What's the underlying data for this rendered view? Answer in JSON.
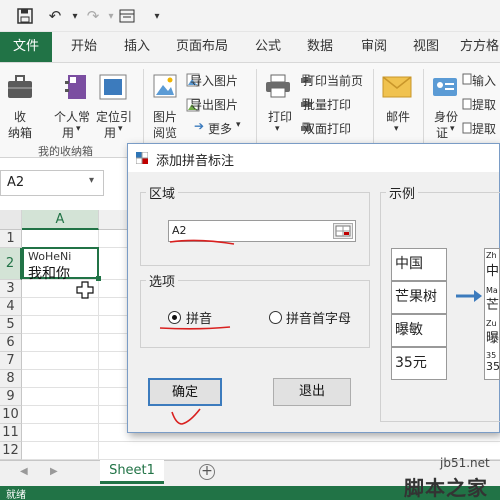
{
  "ribbon_tabs": [
    "文件",
    "开始",
    "插入",
    "页面布局",
    "公式",
    "数据",
    "审阅",
    "视图",
    "方方格"
  ],
  "ribbon": {
    "btn_collect_l1": "收",
    "btn_collect_l2": "纳箱",
    "btn_personal_l1": "个人常",
    "btn_personal_l2": "用",
    "btn_locate_l1": "定位引",
    "btn_locate_l2": "用",
    "group_name": "我的收纳箱",
    "btn_imgview_l1": "图片",
    "btn_imgview_l2": "阅览",
    "import_image": "导入图片",
    "export_image": "导出图片",
    "more": "更多",
    "btn_print": "打印",
    "print_current": "打印当前页",
    "batch_print": "批量打印",
    "duplex_print": "双面打印",
    "btn_mail": "邮件",
    "btn_id_l1": "身份",
    "btn_id_l2": "证",
    "input_cut": "输入",
    "extract1": "提取",
    "extract2": "提取"
  },
  "namebox": "A2",
  "columns": [
    "A"
  ],
  "rows": [
    "1",
    "2",
    "3",
    "4",
    "5",
    "6",
    "7",
    "8",
    "9",
    "10",
    "11",
    "12"
  ],
  "cell_a2": {
    "pinyin": "WoHeNi",
    "text": "我和你"
  },
  "sheet_tab": "Sheet1",
  "status_text": "就绪",
  "dialog": {
    "title": "添加拼音标注",
    "region_label": "区域",
    "region_value": "A2",
    "options_label": "选项",
    "radio_pinyin": "拼音",
    "radio_initials": "拼音首字母",
    "ok": "确定",
    "exit": "退出",
    "example_label": "示例",
    "example_cells": [
      "中国",
      "芒果树",
      "曝敏",
      "35元"
    ],
    "example_result_pinyin": [
      "Zh",
      "Ma",
      "Zu",
      "35"
    ],
    "example_result_text": [
      "中",
      "芒",
      "曝",
      "35"
    ]
  },
  "watermark": {
    "site": "jb51.net",
    "brand": "脚本之家"
  },
  "colors": {
    "excel_green": "#217346",
    "annotation_red": "#d9201f",
    "arrow_blue": "#3c7bbd",
    "selection_green": "#217346"
  }
}
